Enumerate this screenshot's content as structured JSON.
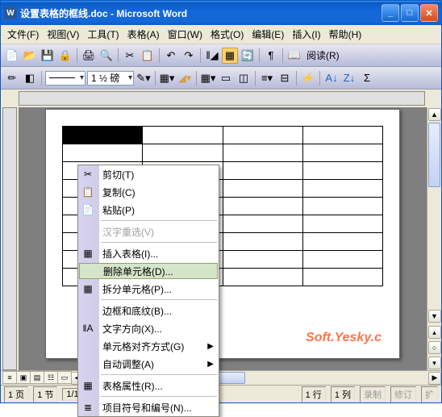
{
  "titlebar": {
    "app_icon_text": "W",
    "title": "设置表格的框线.doc - Microsoft Word"
  },
  "menubar": {
    "file": "文件(F)",
    "view": "视图(V)",
    "tool": "工具(T)",
    "table": "表格(A)",
    "window": "窗口(W)",
    "format": "格式(O)",
    "edit": "编辑(E)",
    "insert": "插入(I)",
    "help": "帮助(H)"
  },
  "toolbar2": {
    "read_label": "阅读(R)"
  },
  "toolbar3": {
    "line_weight": "1 ½ 磅"
  },
  "context_menu": {
    "cut": "剪切(T)",
    "copy": "复制(C)",
    "paste": "粘贴(P)",
    "hanzi": "汉字重选(V)",
    "insert_table": "插入表格(I)...",
    "delete_cells": "删除单元格(D)...",
    "split_cells": "拆分单元格(P)...",
    "borders": "边框和底纹(B)...",
    "text_dir": "文字方向(X)...",
    "cell_align": "单元格对齐方式(G)",
    "autofit": "自动调整(A)",
    "table_props": "表格属性(R)...",
    "bullets": "项目符号和编号(N)..."
  },
  "statusbar": {
    "page": "1 页",
    "section": "1 节",
    "pages": "1/1",
    "line": "1 行",
    "col": "1 列",
    "rec": "录制",
    "rev": "修订",
    "ext": "扩"
  },
  "watermark": "Soft.Yesky.c",
  "icons": {
    "cut": "✂",
    "copy": "📋",
    "paste": "📄",
    "grid": "▦"
  }
}
